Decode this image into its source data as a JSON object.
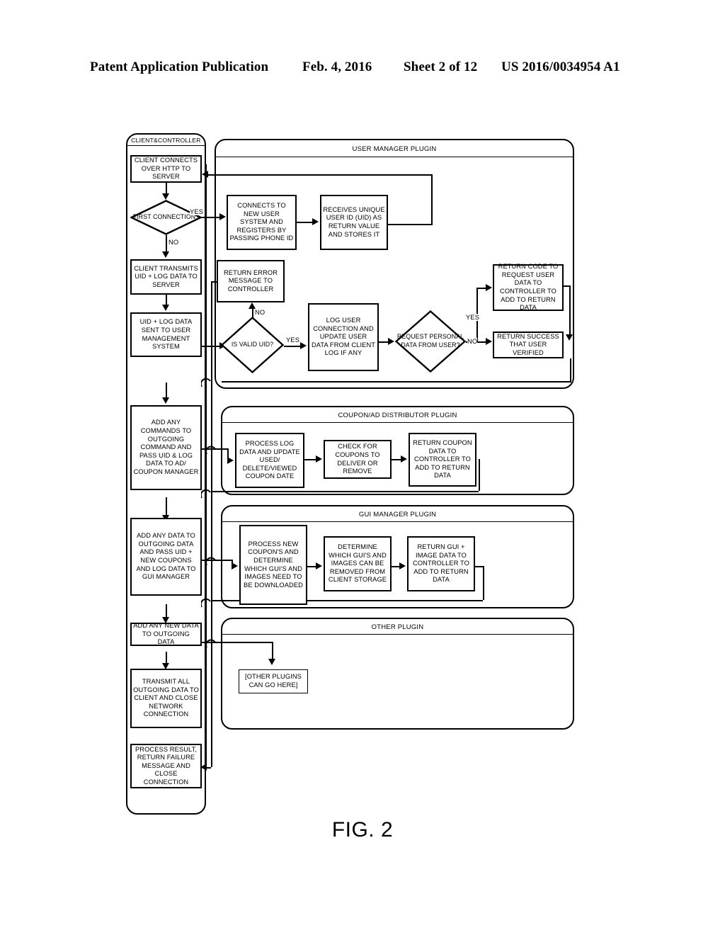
{
  "header": {
    "publication": "Patent Application Publication",
    "date": "Feb. 4, 2016",
    "sheet": "Sheet 2 of 12",
    "number": "US 2016/0034954 A1"
  },
  "figure": {
    "caption": "FIG. 2"
  },
  "lanes": [
    {
      "id": "client",
      "title": "CLIENT&CONTROLLER"
    },
    {
      "id": "user_manager",
      "title": "USER MANAGER PLUGIN"
    },
    {
      "id": "coupon",
      "title": "COUPON/AD DISTRIBUTOR PLUGIN"
    },
    {
      "id": "gui",
      "title": "GUI MANAGER PLUGIN"
    },
    {
      "id": "other",
      "title": "OTHER PLUGIN"
    }
  ],
  "client_lane": {
    "n1": "CLIENT CONNECTS OVER HTTP TO SERVER",
    "d1": "FIRST CONNECTION?",
    "d1_yes": "YES",
    "d1_no": "NO",
    "n2": "CLIENT TRANSMITS UID + LOG DATA TO SERVER",
    "n3": "UID + LOG DATA SENT TO USER MANAGEMENT SYSTEM",
    "n4": "ADD ANY COMMANDS TO OUTGOING COMMAND AND PASS UID & LOG DATA TO AD/ COUPON MANAGER",
    "n5": "ADD ANY DATA TO OUTGOING DATA AND PASS UID + NEW COUPONS AND LOG DATA TO GUI MANAGER",
    "n6": "ADD ANY NEW DATA TO OUTGOING DATA",
    "n7": "TRANSMIT ALL OUTGOING DATA TO CLIENT AND CLOSE NETWORK CONNECTION",
    "n8": "PROCESS RESULT, RETURN FAILURE MESSAGE AND CLOSE CONNECTION"
  },
  "user_manager_lane": {
    "n1": "CONNECTS TO NEW USER SYSTEM AND REGISTERS BY PASSING PHONE ID",
    "n2": "RECEIVES UNIQUE USER ID (UID) AS RETURN VALUE AND STORES IT",
    "n3": "RETURN ERROR MESSAGE TO CONTROLLER",
    "d1": "IS VALID UID?",
    "d1_no": "NO",
    "d1_yes": "YES",
    "n4": "LOG USER CONNECTION AND UPDATE USER DATA FROM CLIENT LOG IF ANY",
    "d2": "REQUEST PERSONAL DATA FROM USER?",
    "d2_yes": "YES",
    "d2_no": "NO",
    "n5": "RETURN CODE TO REQUEST USER DATA TO CONTROLLER TO ADD TO RETURN DATA",
    "n6": "RETURN SUCCESS THAT USER VERIFIED"
  },
  "coupon_lane": {
    "n1": "PROCESS LOG DATA AND UPDATE USED/ DELETE/VIEWED COUPON DATE",
    "n2": "CHECK FOR COUPONS TO DELIVER OR REMOVE",
    "n3": "RETURN COUPON DATA TO CONTROLLER TO ADD TO RETURN DATA"
  },
  "gui_lane": {
    "n1": "PROCESS NEW COUPON'S AND DETERMINE WHICH GUI'S AND IMAGES NEED TO BE DOWNLOADED",
    "n2": "DETERMINE WHICH GUI'S AND IMAGES CAN BE REMOVED FROM CLIENT STORAGE",
    "n3": "RETURN GUI + IMAGE DATA TO CONTROLLER TO ADD TO RETURN DATA"
  },
  "other_lane": {
    "n1": "[OTHER PLUGINS CAN GO HERE]"
  },
  "colors": {
    "ink": "#000000",
    "paper": "#ffffff"
  }
}
